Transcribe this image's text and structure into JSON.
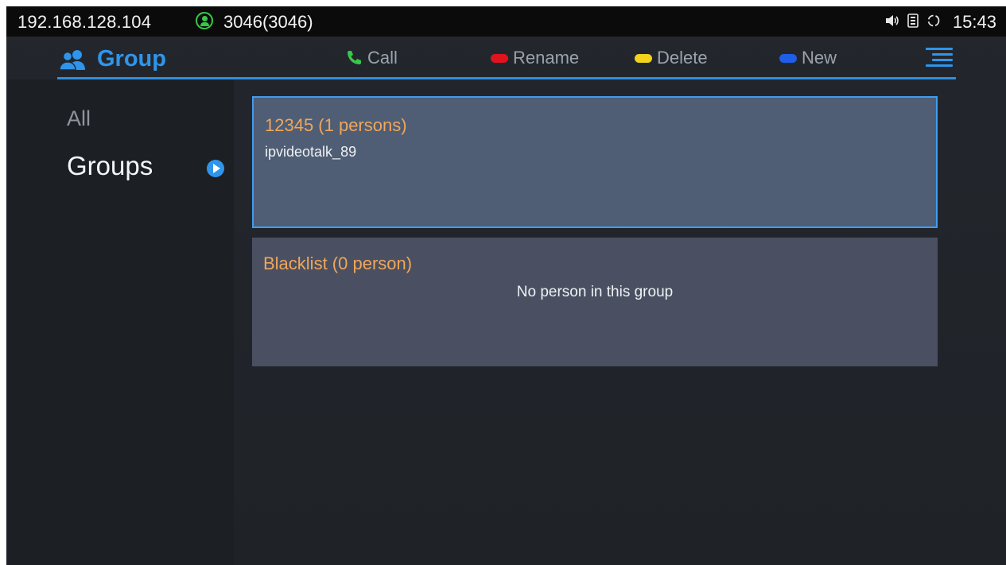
{
  "status_bar": {
    "ip": "192.168.128.104",
    "account": "3046(3046)",
    "time": "15:43",
    "icons": [
      "volume-icon",
      "storage-icon",
      "sync-icon"
    ]
  },
  "action_bar": {
    "title": "Group",
    "actions": [
      {
        "label": "Call",
        "icon": "phone-icon",
        "color": "#37c84a"
      },
      {
        "label": "Rename",
        "color": "#e0141e"
      },
      {
        "label": "Delete",
        "color": "#f2d21c"
      },
      {
        "label": "New",
        "color": "#1e5ee8"
      }
    ]
  },
  "sidebar": {
    "items": [
      {
        "label": "All",
        "active": false
      },
      {
        "label": "Groups",
        "active": true
      }
    ]
  },
  "groups": [
    {
      "name": "12345 (1 persons)",
      "members": [
        "ipvideotalk_89"
      ],
      "selected": true
    },
    {
      "name": "Blacklist (0 person)",
      "empty_text": "No person in this group",
      "selected": false
    }
  ],
  "colors": {
    "accent": "#2f95ec",
    "group_name": "#f0a65b",
    "selected_card": "#4f5e74",
    "card": "#4a5061"
  }
}
